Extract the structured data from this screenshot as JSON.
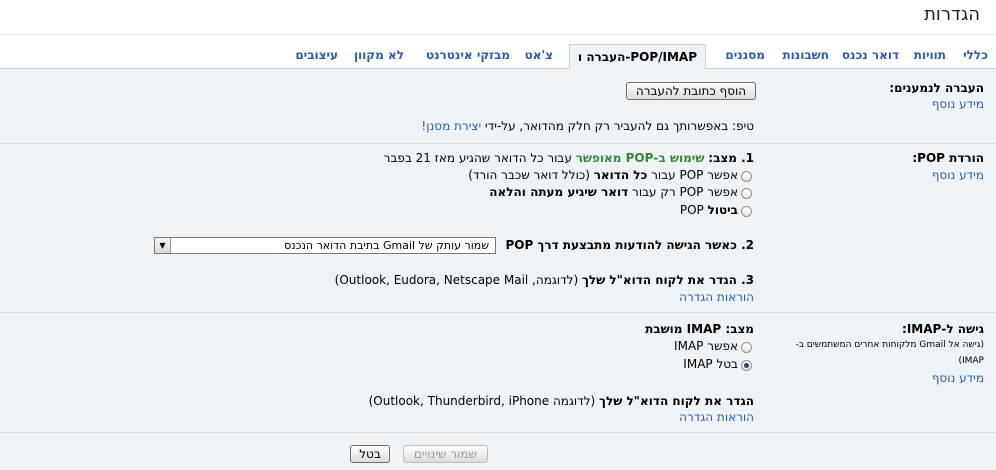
{
  "page": {
    "title": "הגדרות"
  },
  "tabs": [
    {
      "label": "כללי",
      "active": false
    },
    {
      "label": "תוויות",
      "active": false
    },
    {
      "label": "דואר נכנס",
      "active": false
    },
    {
      "label": "חשבונות",
      "active": false
    },
    {
      "label": "מסננים",
      "active": false
    },
    {
      "label": "העברה ו-POP/IMAP",
      "active": true
    },
    {
      "label": "צ'אט",
      "active": false
    },
    {
      "label": "מבזקי אינטרנט",
      "active": false
    },
    {
      "label": "לא מקוון",
      "active": false
    },
    {
      "label": "עיצובים",
      "active": false
    }
  ],
  "forwarding": {
    "label": "העברה לנמענים:",
    "more_info": "מידע נוסף",
    "add_button": "הוסף כתובת להעברה",
    "tip_prefix": "טיפ: באפשרותך גם להעביר רק חלק מהדואר, על-ידי",
    "tip_link": "יצירת מסנן!"
  },
  "pop": {
    "label": "הורדת POP:",
    "more_info": "מידע נוסף",
    "step1_prefix": "1. מצב:",
    "step1_status": "שימוש ב-POP מאופשר",
    "step1_suffix": "עבור כל הדואר שהגיע מאז 21 בפבר",
    "options": [
      {
        "pre": "אפשר POP עבור",
        "bold": "כל הדואר",
        "post": "(כולל דואר שכבר הורד)",
        "checked": false
      },
      {
        "pre": "אפשר POP רק עבור",
        "bold": "דואר שיגיע מעתה והלאה",
        "post": "",
        "checked": false
      },
      {
        "pre": "",
        "bold": "ביטול",
        "post": "POP",
        "checked": false
      }
    ],
    "step2_label": "2. כאשר הגישה להודעות מתבצעת דרך POP",
    "step2_value": "שמור עותק של Gmail בתיבת הדואר הנכנס",
    "step3_label": "3. הגדר את לקוח הדוא\"ל שלך",
    "step3_examples": "(לדוגמה, Outlook, Eudora, Netscape Mail)",
    "step3_link": "הוראות הגדרה"
  },
  "imap": {
    "label": "גישה ל-IMAP:",
    "desc_line1": "(גישה אל Gmail מלקוחות אחרים המשתמשים ב-",
    "desc_line2": "IMAP)",
    "more_info": "מידע נוסף",
    "status_label": "מצב:",
    "status_value": "IMAP מושבת",
    "options": [
      {
        "label": "אפשר IMAP",
        "checked": false
      },
      {
        "label": "בטל IMAP",
        "checked": true
      }
    ],
    "client_label": "הגדר את לקוח הדוא\"ל שלך",
    "client_examples": "(לדוגמה Outlook, Thunderbird, iPhone)",
    "client_link": "הוראות הגדרה"
  },
  "footer": {
    "save_button": "שמור שינויים",
    "cancel_button": "בטל"
  }
}
